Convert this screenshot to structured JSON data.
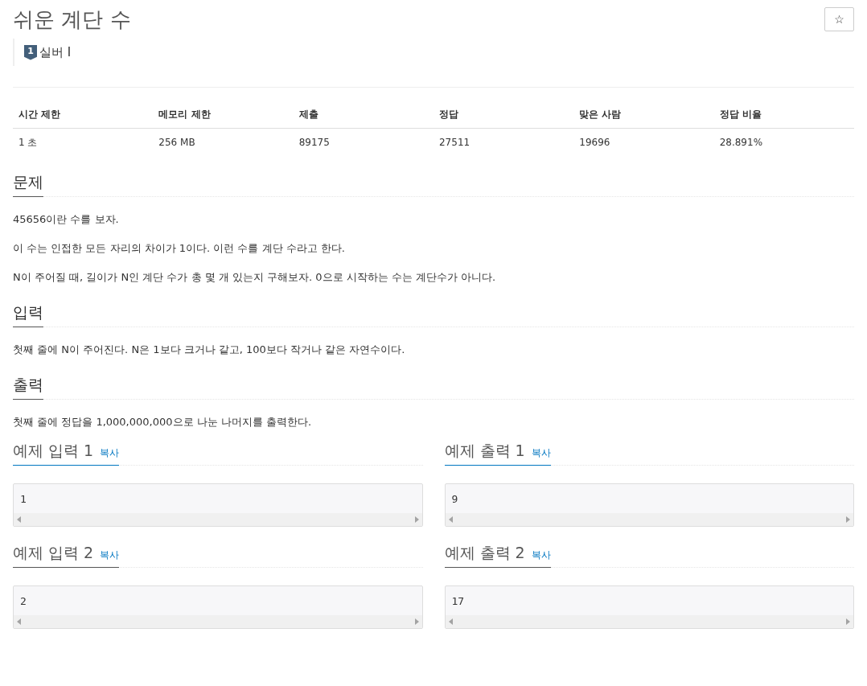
{
  "title": "쉬운 계단 수",
  "star_button": "☆",
  "tier": {
    "badge": "1",
    "label": "실버 I"
  },
  "stats": {
    "columns": [
      "시간 제한",
      "메모리 제한",
      "제출",
      "정답",
      "맞은 사람",
      "정답 비율"
    ],
    "row": [
      "1 초",
      "256 MB",
      "89175",
      "27511",
      "19696",
      "28.891%"
    ]
  },
  "sections": [
    {
      "heading": "문제",
      "paragraphs": [
        "45656이란 수를 보자.",
        "이 수는 인접한 모든 자리의 차이가 1이다. 이런 수를 계단 수라고 한다.",
        "N이 주어질 때, 길이가 N인 계단 수가 총 몇 개 있는지 구해보자. 0으로 시작하는 수는 계단수가 아니다."
      ]
    },
    {
      "heading": "입력",
      "paragraphs": [
        "첫째 줄에 N이 주어진다. N은 1보다 크거나 같고, 100보다 작거나 같은 자연수이다."
      ]
    },
    {
      "heading": "출력",
      "paragraphs": [
        "첫째 줄에 정답을 1,000,000,000으로 나눈 나머지를 출력한다."
      ]
    }
  ],
  "samples": [
    {
      "heading": "예제 입력 1",
      "copy": "복사",
      "highlighted": true,
      "content": "1"
    },
    {
      "heading": "예제 출력 1",
      "copy": "복사",
      "highlighted": true,
      "content": "9"
    },
    {
      "heading": "예제 입력 2",
      "copy": "복사",
      "highlighted": false,
      "content": "2"
    },
    {
      "heading": "예제 출력 2",
      "copy": "복사",
      "highlighted": false,
      "content": "17"
    }
  ]
}
